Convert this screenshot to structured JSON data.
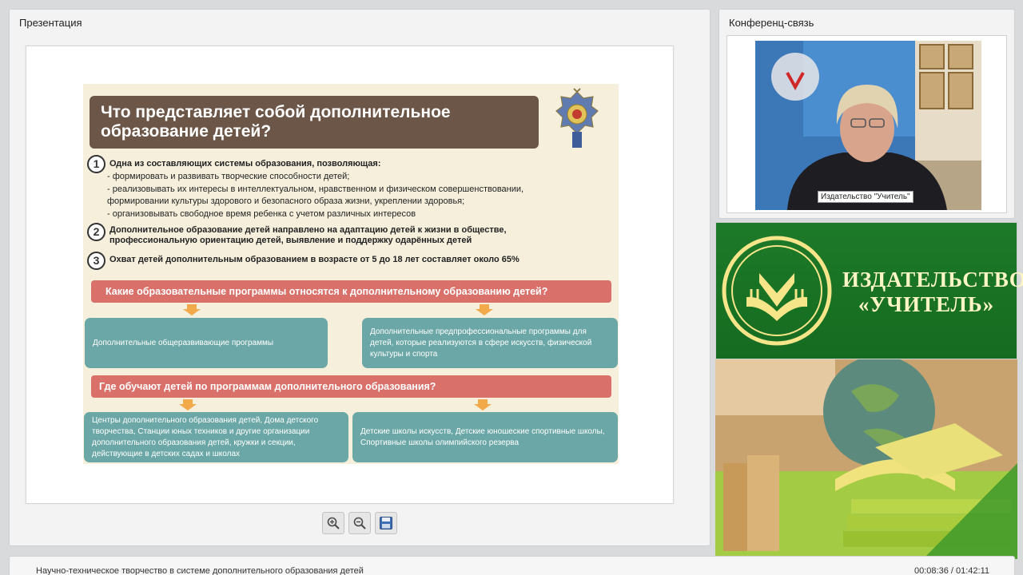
{
  "presentation": {
    "panel_title": "Презентация",
    "slide": {
      "title": "Что представляет собой дополнительное образование детей?",
      "items": [
        {
          "number": "1",
          "heading": "Одна из составляющих системы образования, позволяющая:",
          "bullets": [
            "- формировать и развивать творческие способности детей;",
            "- реализовывать их интересы в интеллектуальном, нравственном и физическом совершенствовании, формировании культуры здорового и безопасного образа жизни, укреплении здоровья;",
            "- организовывать свободное время ребенка с учетом различных интересов"
          ]
        },
        {
          "number": "2",
          "heading": "Дополнительное образование детей направлено на адаптацию детей к жизни в обществе, профессиональную ориентацию детей, выявление и поддержку одарённых детей"
        },
        {
          "number": "3",
          "heading": "Охват детей дополнительным образованием в возрасте от 5 до 18 лет составляет около 65%"
        }
      ],
      "question1": "Какие образовательные программы относятся к дополнительному образованию детей?",
      "q1_answers": [
        "Дополнительные общеразвивающие программы",
        "Дополнительные предпрофессиональные программы для детей, которые реализуются в сфере искусств, физической культуры и спорта"
      ],
      "question2": "Где обучают детей по программам дополнительного образования?",
      "q2_answers": [
        "Центры дополнительного образования детей, Дома детского творчества, Станции юных техников и другие организации дополнительного образования детей, кружки и секции, действующие в детских садах и школах",
        "Детские школы искусств, Детские юношеские спортивные школы, Спортивные школы олимпийского резерва"
      ]
    },
    "toolbar": {
      "zoom_in_icon": "zoom-in-icon",
      "zoom_out_icon": "zoom-out-icon",
      "save_icon": "save-icon"
    }
  },
  "conference": {
    "panel_title": "Конференц-связь",
    "video_label": "Издательство \"Учитель\""
  },
  "banner": {
    "title_line1": "ИЗДАТЕЛЬСТВО",
    "title_line2": "«УЧИТЕЛЬ»"
  },
  "footer": {
    "title": "Научно-техническое творчество в системе дополнительного образования детей",
    "time": "00:08:36 / 01:42:11"
  },
  "colors": {
    "slide_title_bg": "#6c5648",
    "pink_bar": "#d9716a",
    "teal_box": "#6ba7a6",
    "arrow": "#f1a94a",
    "banner_green": "#1d7a29"
  }
}
